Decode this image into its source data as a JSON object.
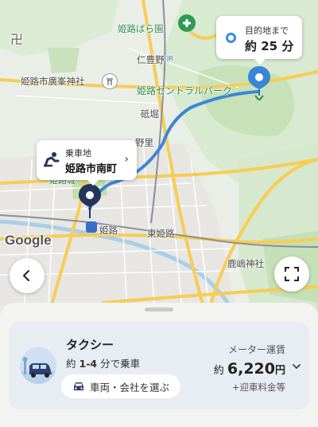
{
  "map": {
    "labels": {
      "himeji_rose_garden": "姫路ばら園",
      "himeji_gokoku_shrine": "姫路市廣峯神社",
      "nibuno": "仁豊野",
      "central_park": "姫路セントラルパーク",
      "toori": "砥堀",
      "nozato": "野里",
      "himeji_castle": "姫路城",
      "higashi_himeji": "東姫路",
      "kashima_shrine": "鹿嶋神社",
      "jr_badge": "JR",
      "swastika": "卍",
      "station_name": "姫路"
    },
    "colors": {
      "park_green": "#c7e2b8",
      "road_yellow": "#f6cd54",
      "route_blue": "#3a86d6",
      "pin_dark": "#25355a"
    }
  },
  "destination_callout": {
    "icon": "destination-ring-icon",
    "label": "目的地まで",
    "time": "約 25 分"
  },
  "pickup_callout": {
    "icon": "passenger-seat-icon",
    "label": "乗車地",
    "place": "姫路市南町",
    "chevron": "›"
  },
  "google_logo": "Google",
  "controls": {
    "back_icon": "chevron-left-icon",
    "fullscreen_icon": "fullscreen-icon"
  },
  "ride_card": {
    "service_name": "タクシー",
    "eta_prefix": "約",
    "eta_range": "1-4",
    "eta_suffix": "分で乗車",
    "choose_button": "車両・会社を選ぶ",
    "fare_label": "メーター運賃",
    "fare_prefix": "約",
    "fare_amount": "6,220",
    "fare_currency": "円",
    "fare_note": "+迎車料金等"
  }
}
